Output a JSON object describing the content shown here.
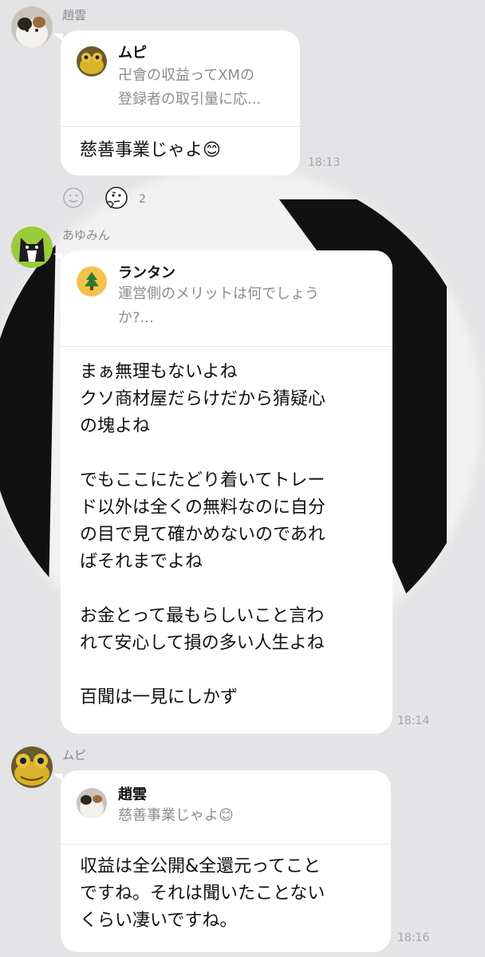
{
  "messages": [
    {
      "sender": "趙雲",
      "avatar_icon": "calico-cat-avatar-icon",
      "reply_to": {
        "name": "ムピ",
        "icon": "frog-avatar-icon",
        "text": "卍會の収益ってXMの\n登録者の取引量に応..."
      },
      "text": "慈善事業じゃよ😊",
      "time": "18:13",
      "reactions": {
        "add_icon": "smiley-outline-icon",
        "icon": "thinking-face-icon",
        "count": "2"
      }
    },
    {
      "sender": "あゆみん",
      "avatar_icon": "tuxedo-cat-avatar-icon",
      "reply_to": {
        "name": "ランタン",
        "icon": "tree-avatar-icon",
        "text": "運営側のメリットは何でしょう\nか?..."
      },
      "text": "まぁ無理もないよね\nクソ商材屋だらけだから猜疑心\nの塊よね\n\nでもここにたどり着いてトレー\nド以外は全くの無料なのに自分\nの目で見て確かめないのであれ\nばそれまでよね\n\nお金とって最もらしいこと言わ\nれて安心して損の多い人生よね\n\n百聞は一見にしかず",
      "time": "18:14"
    },
    {
      "sender": "ムピ",
      "avatar_icon": "frog-avatar-icon",
      "reply_to": {
        "name": "趙雲",
        "icon": "calico-cat-avatar-icon",
        "text": "慈善事業じゃよ😊"
      },
      "text": "収益は全公開&全還元ってこと\nですね。それは聞いたことない\nくらい凄いですね。",
      "time": "18:16"
    }
  ],
  "colors": {
    "background": "#e4e4e6",
    "bubble": "#ffffff",
    "time": "#a6a6aa"
  }
}
